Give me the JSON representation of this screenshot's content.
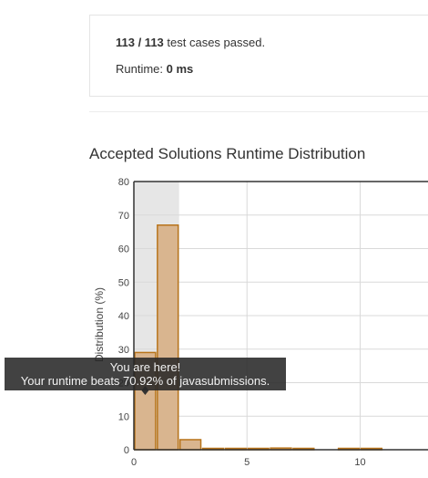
{
  "result": {
    "cases_passed": "113 / 113",
    "cases_suffix": " test cases passed.",
    "runtime_label": "Runtime: ",
    "runtime_value": "0 ms"
  },
  "distribution": {
    "title": "Accepted Solutions Runtime Distribution"
  },
  "tooltip": {
    "line1": "You are here!",
    "line2": "Your runtime beats 70.92% of javasubmissions."
  },
  "colors": {
    "bar_fill": "#d9b58f",
    "bar_stroke": "#b8741a",
    "highlight_band": "#e6e6e6",
    "grid": "#d9d9d9",
    "axis": "#333333"
  },
  "chart_data": {
    "type": "bar",
    "title": "Accepted Solutions Runtime Distribution",
    "ylabel": "Distribution (%)",
    "xlabel": "",
    "x_bins": [
      0,
      1,
      2,
      3,
      4,
      5,
      6,
      7,
      8,
      9,
      10,
      11
    ],
    "bin_width": 1,
    "values": [
      29,
      67,
      3,
      0.3,
      0.2,
      0.2,
      0.5,
      0.3,
      0,
      0.4,
      0.3,
      0
    ],
    "ylim": [
      0,
      80
    ],
    "xlim": [
      0,
      13
    ],
    "yticks": [
      0,
      10,
      20,
      30,
      40,
      50,
      60,
      70,
      80
    ],
    "xticks": [
      0,
      5,
      10
    ],
    "highlight_range": [
      0,
      2
    ],
    "your_runtime": 0.5,
    "grid": true
  }
}
